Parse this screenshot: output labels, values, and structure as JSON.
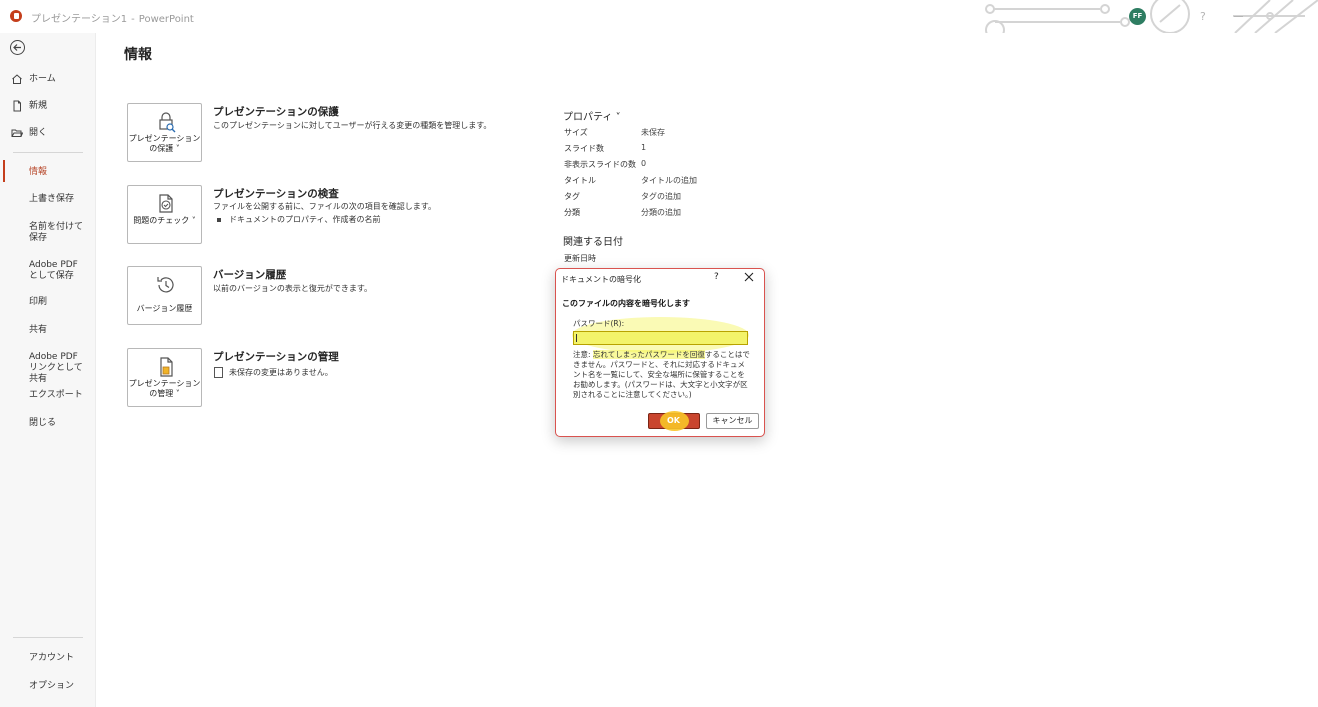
{
  "titlebar": {
    "doc_name": "プレゼンテーション1",
    "separator": "-",
    "app_name": "PowerPoint",
    "avatar_initials": "FF",
    "help": "?"
  },
  "sidebar": {
    "items": [
      {
        "label": "ホーム",
        "icon": "home-icon"
      },
      {
        "label": "新規",
        "icon": "new-document-icon"
      },
      {
        "label": "開く",
        "icon": "open-folder-icon"
      },
      {
        "label": "情報"
      },
      {
        "label": "上書き保存"
      },
      {
        "label": "名前を付けて保存"
      },
      {
        "label": "Adobe PDF として保存"
      },
      {
        "label": "印刷"
      },
      {
        "label": "共有"
      },
      {
        "label": "Adobe PDF リンクとして共有"
      },
      {
        "label": "エクスポート"
      },
      {
        "label": "閉じる"
      }
    ],
    "bottom_items": [
      {
        "label": "アカウント"
      },
      {
        "label": "オプション"
      }
    ]
  },
  "main": {
    "title": "情報",
    "sections": [
      {
        "button_label": "プレゼンテーションの保護 ˅",
        "title": "プレゼンテーションの保護",
        "description": "このプレゼンテーションに対してユーザーが行える変更の種類を管理します。"
      },
      {
        "button_label": "問題のチェック ˅",
        "title": "プレゼンテーションの検査",
        "description": "ファイルを公開する前に、ファイルの次の項目を確認します。",
        "bullet": "ドキュメントのプロパティ、作成者の名前"
      },
      {
        "button_label": "バージョン履歴",
        "title": "バージョン履歴",
        "description": "以前のバージョンの表示と復元ができます。"
      },
      {
        "button_label": "プレゼンテーションの管理 ˅",
        "title": "プレゼンテーションの管理",
        "description": "未保存の変更はありません。"
      }
    ]
  },
  "properties": {
    "heading": "プロパティ ˅",
    "rows": [
      {
        "label": "サイズ",
        "value": "未保存"
      },
      {
        "label": "スライド数",
        "value": "1"
      },
      {
        "label": "非表示スライドの数",
        "value": "0"
      },
      {
        "label": "タイトル",
        "value": "タイトルの追加"
      },
      {
        "label": "タグ",
        "value": "タグの追加"
      },
      {
        "label": "分類",
        "value": "分類の追加"
      }
    ],
    "dates_heading": "関連する日付",
    "dates_rows": [
      {
        "label": "更新日時"
      }
    ]
  },
  "dialog": {
    "title": "ドキュメントの暗号化",
    "help": "?",
    "heading": "このファイルの内容を暗号化します",
    "password_label": "パスワード(R):",
    "password_value": "",
    "note_part1": "注意: ",
    "note_highlight": "忘れてしまったパスワードを回復",
    "note_part2": "することはできません。パスワードと、それに対応するドキュメント名を一覧にして、安全な場所に保管することをお勧めします。(パスワードは、大文字と小文字が区別されることに注意してください。)",
    "ok_label": "OK",
    "cancel_label": "キャンセル"
  }
}
